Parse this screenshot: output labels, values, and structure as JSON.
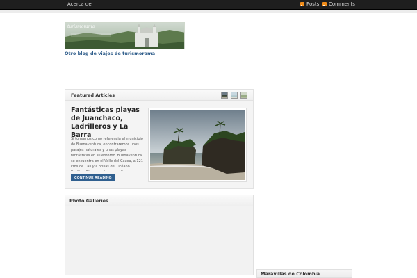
{
  "topbar": {
    "about_label": "Acerca de",
    "posts_label": "Posts",
    "comments_label": "Comments"
  },
  "logo": {
    "text": "turismorama",
    "icon": "church-landscape-logo"
  },
  "site": {
    "tagline": "Otro blog de viajes de turismorama"
  },
  "featured": {
    "heading": "Featured Articles",
    "article_title": "Fantásticas playas de Juanchaco, Ladrilleros y La Barra",
    "excerpt": "Si tomamos como referencia el municipio de Buenaventura, encontraremos unos parajes naturales y unas playas fantásticas en su entorno. Buenaventura se encuentra en el Valle del Cauca, a 121 kms de Cali y a orillas del Océano Pacífico. El accidente geográfico que vamos a ver es el conjunto de",
    "continue_label": "CONTINUE READING",
    "thumbnails": [
      "thumb-beach-dark",
      "thumb-beach-light",
      "thumb-landscape"
    ]
  },
  "galleries": {
    "heading": "Photo Galleries"
  },
  "sidebar": {
    "widget_title": "Maravillas de Colombia"
  },
  "colors": {
    "topbar": "#1e1e1e",
    "link": "#2e5c8a",
    "button": "#2f5f8f",
    "rss": "#f08c1a"
  }
}
